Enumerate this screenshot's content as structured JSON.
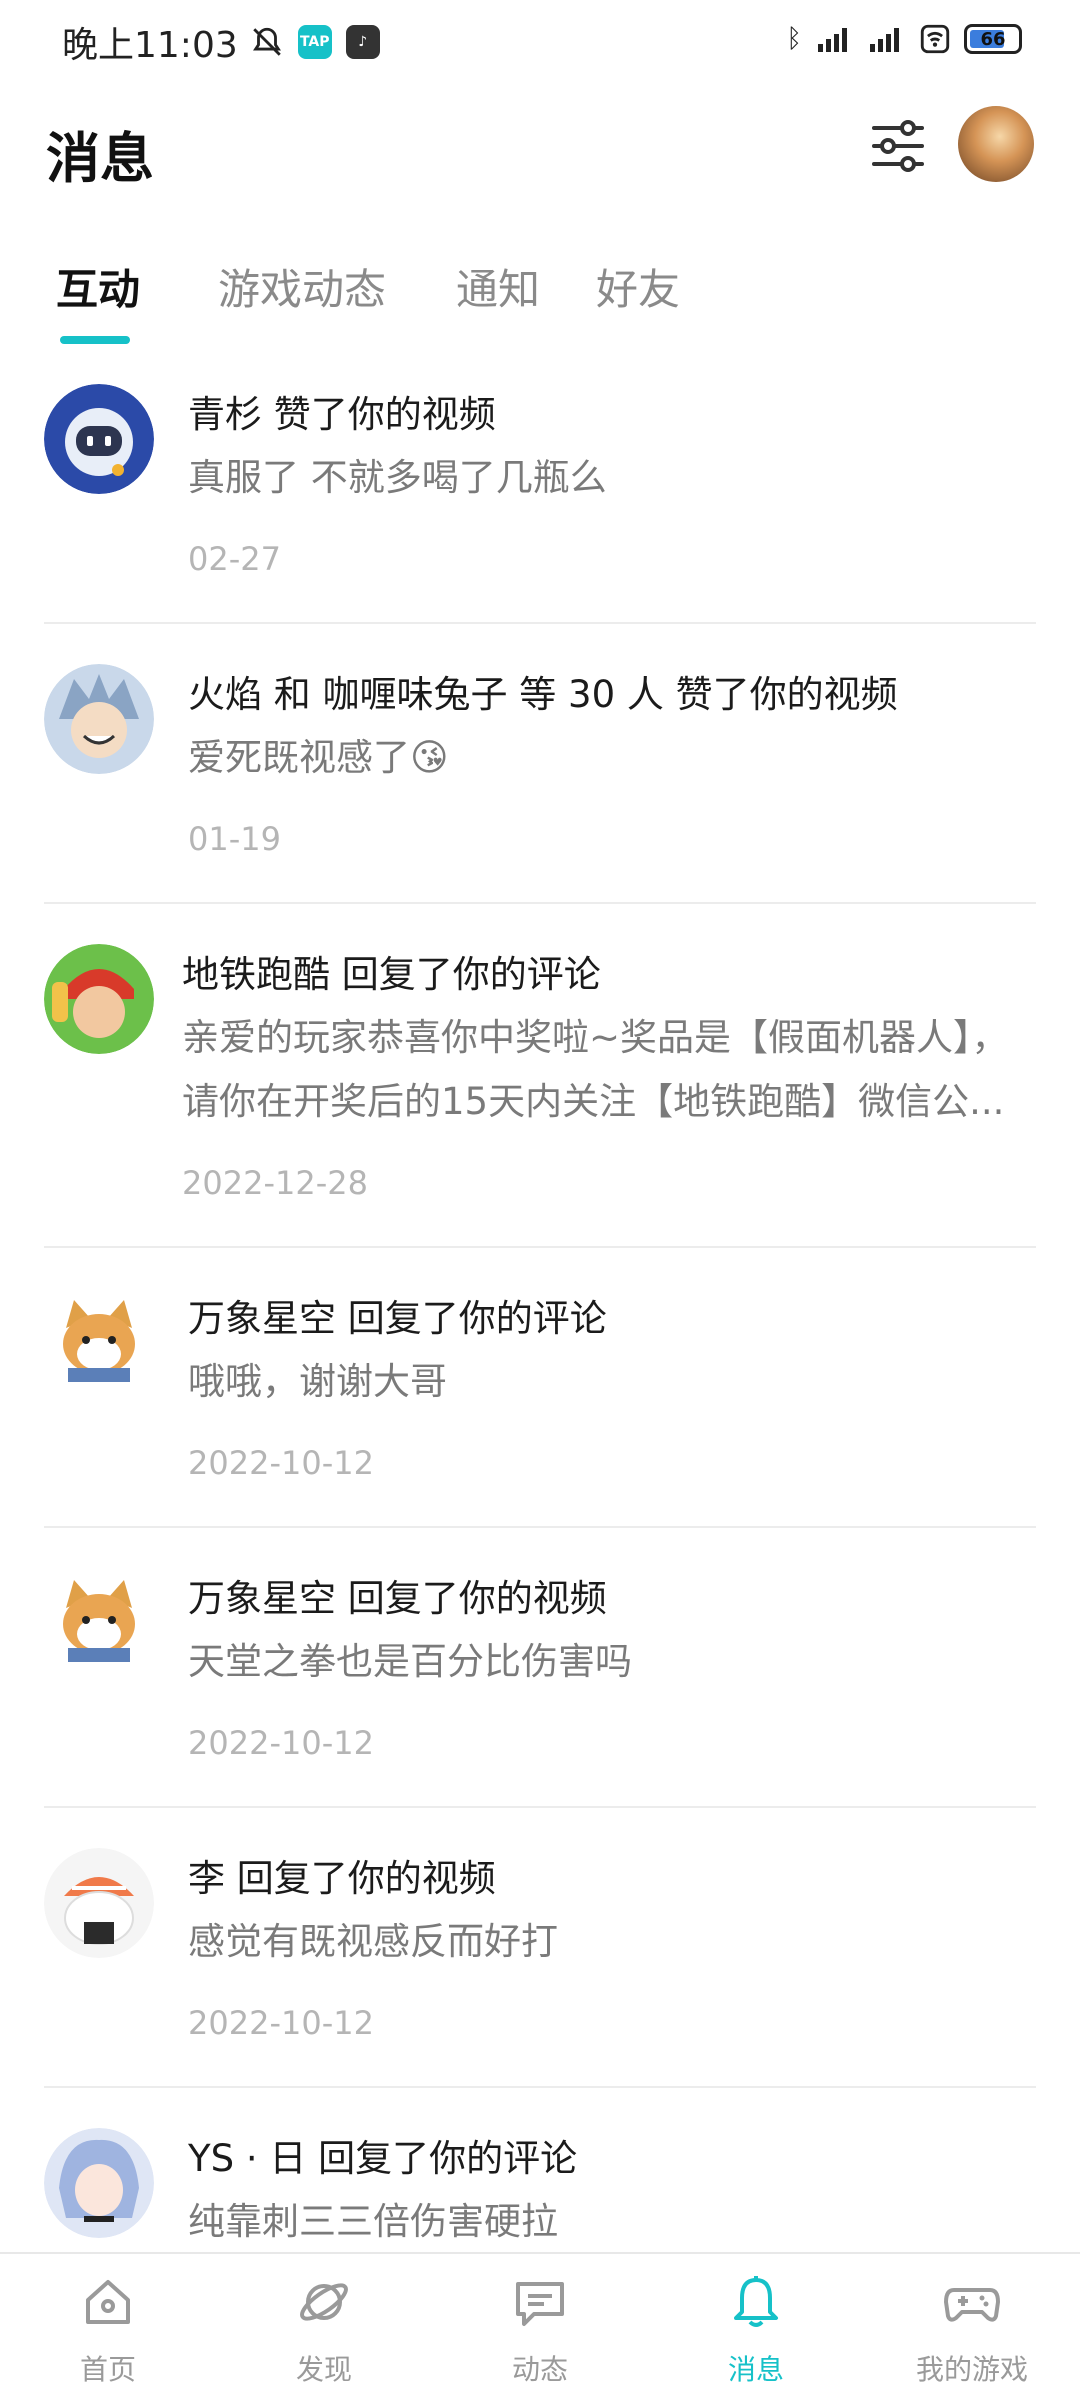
{
  "status_bar": {
    "time": "晚上11:03",
    "battery": "66"
  },
  "header": {
    "title": "消息"
  },
  "tabs": [
    {
      "label": "互动",
      "active": true
    },
    {
      "label": "游戏动态",
      "active": false
    },
    {
      "label": "通知",
      "active": false
    },
    {
      "label": "好友",
      "active": false
    }
  ],
  "messages": [
    {
      "title": "青杉 赞了你的视频",
      "body": "真服了  不就多喝了几瓶么",
      "date": "02-27"
    },
    {
      "title": "火焰 和 咖喱味兔子 等 30 人 赞了你的视频",
      "body": "爱死既视感了😘",
      "date": "01-19"
    },
    {
      "title": "地铁跑酷 回复了你的评论",
      "body": "亲爱的玩家恭喜你中奖啦~奖品是【假面机器人】，请你在开奖后的15天内关注【地铁跑酷】微信公...",
      "date": "2022-12-28"
    },
    {
      "title": "万象星空 回复了你的评论",
      "body": "哦哦，谢谢大哥",
      "date": "2022-10-12"
    },
    {
      "title": "万象星空 回复了你的视频",
      "body": "天堂之拳也是百分比伤害吗",
      "date": "2022-10-12"
    },
    {
      "title": "李 回复了你的视频",
      "body": "感觉有既视感反而好打",
      "date": "2022-10-12"
    },
    {
      "title": "YS · 日 回复了你的评论",
      "body": "纯靠刺三三倍伤害硬拉",
      "date": ""
    }
  ],
  "bottom_nav": [
    {
      "label": "首页",
      "icon": "home-icon",
      "active": false
    },
    {
      "label": "发现",
      "icon": "planet-icon",
      "active": false
    },
    {
      "label": "动态",
      "icon": "chat-icon",
      "active": false
    },
    {
      "label": "消息",
      "icon": "bell-icon",
      "active": true
    },
    {
      "label": "我的游戏",
      "icon": "gamepad-icon",
      "active": false
    }
  ],
  "colors": {
    "accent": "#16c1c8"
  }
}
